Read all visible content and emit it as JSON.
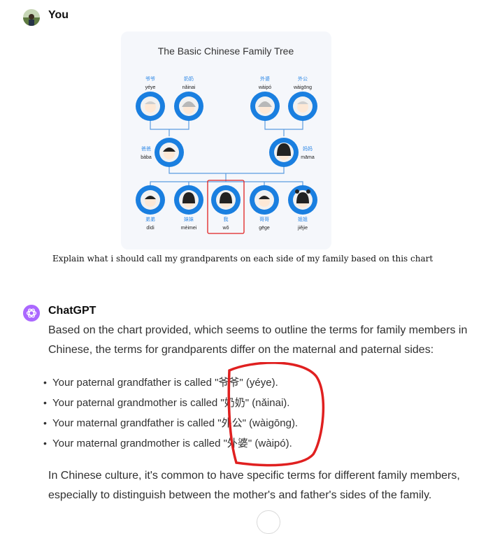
{
  "user": {
    "name": "You"
  },
  "assistant": {
    "name": "ChatGPT"
  },
  "attachment": {
    "title": "The Basic Chinese Family Tree",
    "members": [
      {
        "hanzi": "爷爷",
        "pinyin": "yéye"
      },
      {
        "hanzi": "奶奶",
        "pinyin": "nǎinai"
      },
      {
        "hanzi": "外婆",
        "pinyin": "wàipó"
      },
      {
        "hanzi": "外公",
        "pinyin": "wàigōng"
      },
      {
        "hanzi": "爸爸",
        "pinyin": "bàba"
      },
      {
        "hanzi": "妈妈",
        "pinyin": "māma"
      },
      {
        "hanzi": "弟弟",
        "pinyin": "dìdi"
      },
      {
        "hanzi": "妹妹",
        "pinyin": "mèimei"
      },
      {
        "hanzi": "我",
        "pinyin": "wǒ"
      },
      {
        "hanzi": "哥哥",
        "pinyin": "gēge"
      },
      {
        "hanzi": "姐姐",
        "pinyin": "jiějie"
      }
    ]
  },
  "prompt": "Explain what i should call my grandparents on each side of my family based on this chart",
  "response": {
    "intro": "Based on the chart provided, which seems to outline the terms for family members in Chinese, the terms for grandparents differ on the maternal and paternal sides:",
    "bullets": [
      "Your paternal grandfather is called \"爷爷\" (yéye).",
      "Your paternal grandmother is called \"奶奶\" (nǎinai).",
      "Your maternal grandfather is called \"外公\" (wàigōng).",
      "Your maternal grandmother is called \"外婆\" (wàipó)."
    ],
    "outro": "In Chinese culture, it's common to have specific terms for different family members, especially to distinguish between the mother's and father's sides of the family."
  },
  "colors": {
    "node_blue": "#1a7fe0",
    "highlight_red": "#e02020",
    "label_blue": "#2a86e6",
    "gpt_purple": "#ab68ff"
  }
}
